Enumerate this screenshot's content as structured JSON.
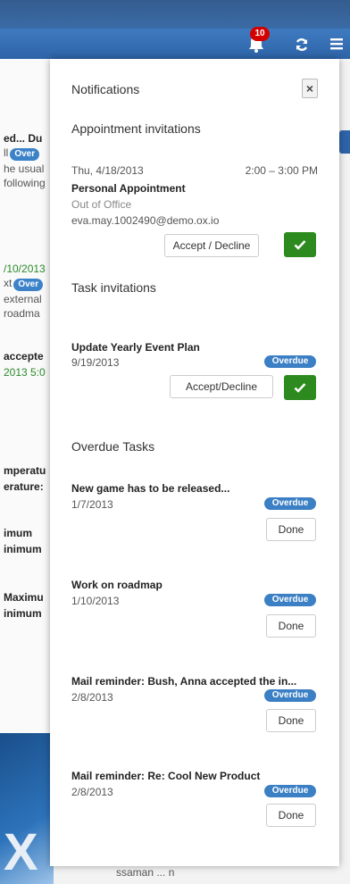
{
  "header": {
    "notification_count": "10",
    "icons": [
      "bell-icon",
      "refresh-icon",
      "menu-icon"
    ]
  },
  "background": {
    "lines": [
      {
        "text": "ed... Du",
        "style": "b"
      },
      {
        "text": "ll",
        "pill": "Over"
      },
      {
        "text": "he usual"
      },
      {
        "text": "following"
      },
      {
        "text": "/10/2013",
        "style": "g"
      },
      {
        "text": "xt",
        "pill": "Over"
      },
      {
        "text": "external"
      },
      {
        "text": "roadma"
      },
      {
        "text": "accepte",
        "style": "b"
      },
      {
        "text": "2013 5:0",
        "style": "g"
      },
      {
        "text": "mperatu",
        "style": "b"
      },
      {
        "text": "erature:",
        "style": "b"
      },
      {
        "text": "imum",
        "style": "b"
      },
      {
        "text": "inimum",
        "style": "b"
      },
      {
        "text": "Maximu",
        "style": "b"
      },
      {
        "text": "inimum",
        "style": "b"
      }
    ],
    "bottom_text": "ssaman ... n"
  },
  "notifications": {
    "title": "Notifications",
    "close_label": "×",
    "appointments": {
      "title": "Appointment invitations",
      "items": [
        {
          "date": "Thu, 4/18/2013",
          "time": "2:00 – 3:00 PM",
          "title": "Personal Appointment",
          "status": "Out of Office",
          "email": "eva.may.1002490@demo.ox.io",
          "action_label": "Accept / Decline"
        }
      ]
    },
    "tasks": {
      "title": "Task invitations",
      "items": [
        {
          "title": "Update Yearly Event Plan",
          "date": "9/19/2013",
          "badge": "Overdue",
          "action_label": "Accept/Decline"
        }
      ]
    },
    "overdue": {
      "title": "Overdue Tasks",
      "items": [
        {
          "title": "New game has to be released...",
          "date": "1/7/2013",
          "badge": "Overdue",
          "action_label": "Done"
        },
        {
          "title": "Work on roadmap",
          "date": "1/10/2013",
          "badge": "Overdue",
          "action_label": "Done"
        },
        {
          "title": "Mail reminder: Bush, Anna accepted the in...",
          "date": "2/8/2013",
          "badge": "Overdue",
          "action_label": "Done"
        },
        {
          "title": "Mail reminder: Re: Cool New Product",
          "date": "2/8/2013",
          "badge": "Overdue",
          "action_label": "Done"
        }
      ]
    }
  },
  "colors": {
    "accent_green": "#2c8a1e",
    "badge_blue": "#3b7fc4",
    "header_blue": "#2e64a8",
    "notification_red": "#d40000"
  }
}
